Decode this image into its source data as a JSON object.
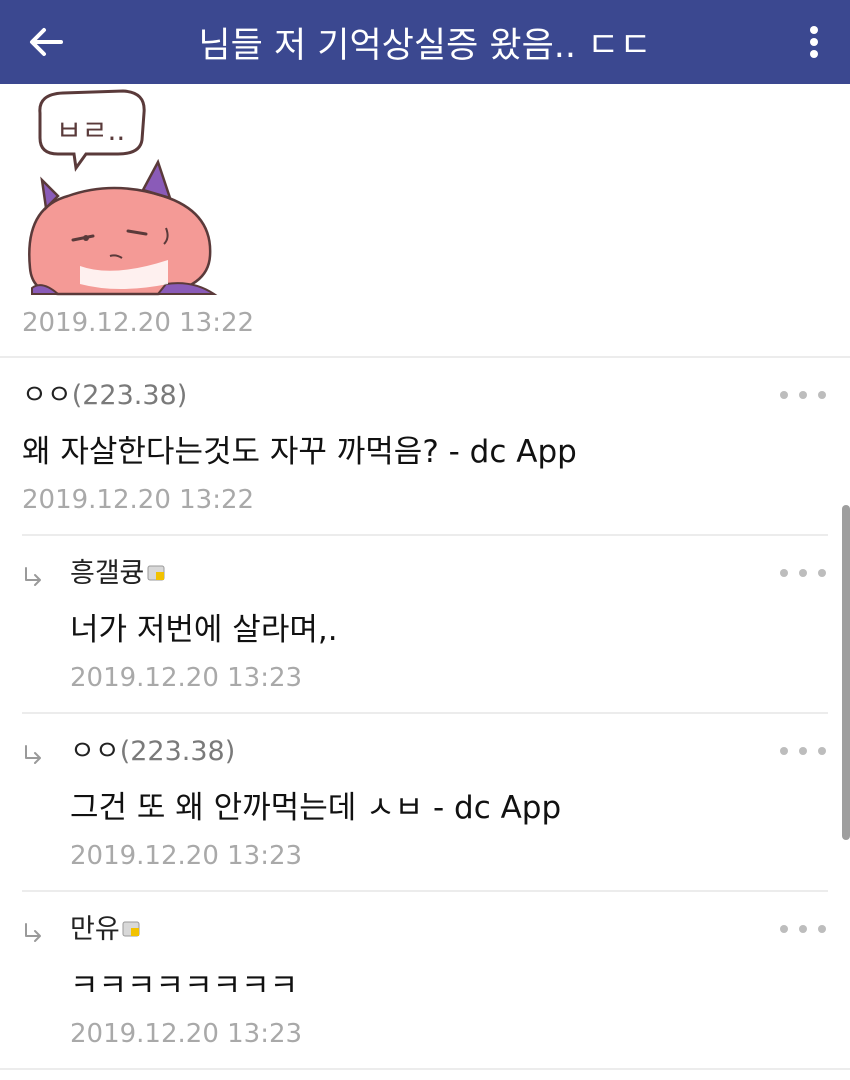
{
  "header": {
    "back_icon": "arrow-left-icon",
    "title": "님들 저 기억상실증 왔음.. ㄷㄷ",
    "more_icon": "more-vertical-icon",
    "background_color": "#3b4890"
  },
  "post": {
    "sticker_text": "ㅂㄹ..",
    "date": "2019.12.20 13:22"
  },
  "comments": [
    {
      "author": "ㅇㅇ",
      "ip": "(223.38)",
      "text": "왜 자살한다는것도 자꾸 까먹음? - dc App",
      "date": "2019.12.20 13:22",
      "is_reply": false
    },
    {
      "author": "흥갤큥",
      "ip": "",
      "text": "너가 저번에 살라며,.",
      "date": "2019.12.20 13:23",
      "is_reply": true
    },
    {
      "author": "ㅇㅇ",
      "ip": "(223.38)",
      "text": "그건 또 왜 안까먹는데 ㅅㅂ - dc App",
      "date": "2019.12.20 13:23",
      "is_reply": true
    },
    {
      "author": "만유",
      "ip": "",
      "text": "ㅋㅋㅋㅋㅋㅋㅋㅋ",
      "date": "2019.12.20 13:23",
      "is_reply": true
    }
  ]
}
